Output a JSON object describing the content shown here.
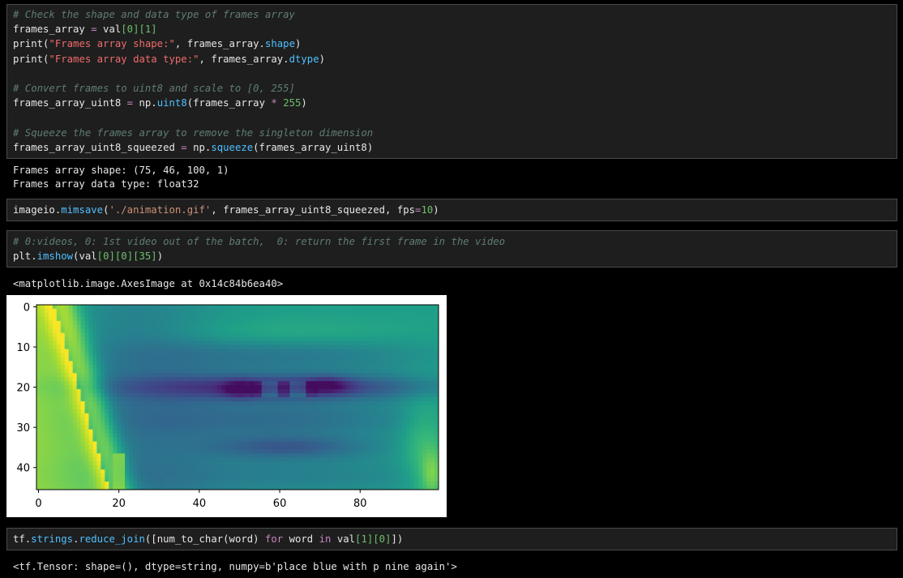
{
  "cells": {
    "cell1": {
      "lines": [
        {
          "comment": "# Check the shape and data type of frames array"
        },
        {
          "a": "frames_array ",
          "op": "=",
          "b": " val",
          "idx": "[0][1]"
        },
        {
          "a": "print(",
          "s": "\"Frames array shape:\"",
          "b": ", frames_array.",
          "attr": "shape",
          "c": ")"
        },
        {
          "a": "print(",
          "s": "\"Frames array data type:\"",
          "b": ", frames_array.",
          "attr": "dtype",
          "c": ")"
        },
        {
          "blank": ""
        },
        {
          "comment": "# Convert frames to uint8 and scale to [0, 255]"
        },
        {
          "a": "frames_array_uint8 ",
          "op": "=",
          "b": " np.",
          "attr": "uint8",
          "c": "(frames_array ",
          "op2": "*",
          "num": " 255",
          "d": ")"
        },
        {
          "blank": ""
        },
        {
          "comment": "# Squeeze the frames array to remove the singleton dimension"
        },
        {
          "a": "frames_array_uint8_squeezed ",
          "op": "=",
          "b": " np.",
          "attr": "squeeze",
          "c": "(frames_array_uint8)"
        }
      ]
    },
    "output1": [
      "Frames array shape: (75, 46, 100, 1)",
      "Frames array data type: float32"
    ],
    "cell2": {
      "a": "imageio.",
      "fn": "mimsave",
      "b": "(",
      "s": "'./animation.gif'",
      "c": ", frames_array_uint8_squeezed, fps",
      "op": "=",
      "num": "10",
      "d": ")"
    },
    "cell3": {
      "comment": "# 0:videos, 0: 1st video out of the batch,  0: return the first frame in the video",
      "a": "plt.",
      "fn": "imshow",
      "b": "(val",
      "idx": "[0][0][35]",
      "c": ")"
    },
    "output3": "<matplotlib.image.AxesImage at 0x14c84b6ea40>",
    "cell4": {
      "a": "tf.",
      "fn": "strings",
      "b": ".",
      "fn2": "reduce_join",
      "c": "([num_to_char(word) ",
      "kw": "for",
      "d": " word ",
      "kw2": "in",
      "e": " val",
      "idx": "[1][0]",
      "f": "])"
    },
    "output4": "<tf.Tensor: shape=(), dtype=string, numpy=b'place blue with p nine again'>"
  },
  "chart_data": {
    "type": "heatmap",
    "colormap": "viridis",
    "image_shape": [
      46,
      100
    ],
    "x_ticks": [
      0,
      20,
      40,
      60,
      80
    ],
    "y_ticks": [
      0,
      10,
      20,
      30,
      40
    ],
    "xlim": [
      -0.5,
      99.5
    ],
    "ylim": [
      45.5,
      -0.5
    ],
    "content": "grayscale video frame of a mouth rendered with viridis colormap"
  }
}
